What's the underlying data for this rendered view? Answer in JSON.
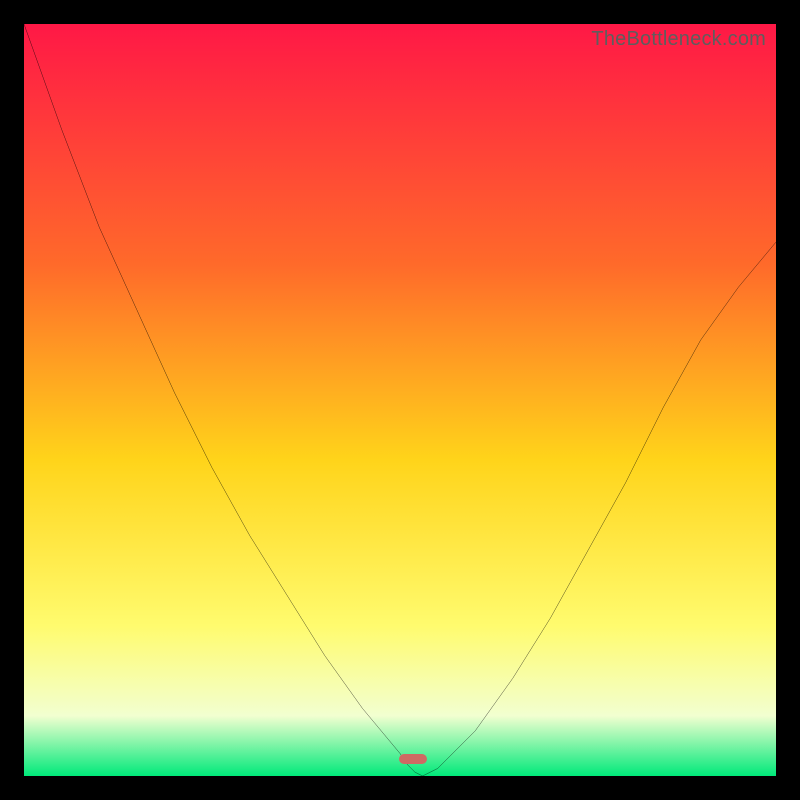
{
  "watermark": "TheBottleneck.com",
  "colors": {
    "frame": "#000000",
    "gradient_top": "#ff1846",
    "gradient_mid1": "#ff6a2a",
    "gradient_mid2": "#ffd41a",
    "gradient_mid3": "#fffb6e",
    "gradient_mid4": "#f2ffd0",
    "gradient_bottom": "#00e97a",
    "curve": "#000000",
    "marker": "#cf6a63"
  },
  "chart_data": {
    "type": "line",
    "title": "",
    "xlabel": "",
    "ylabel": "",
    "x": [
      0.0,
      0.05,
      0.1,
      0.15,
      0.2,
      0.25,
      0.3,
      0.35,
      0.4,
      0.45,
      0.5,
      0.51,
      0.52,
      0.53,
      0.55,
      0.6,
      0.65,
      0.7,
      0.75,
      0.8,
      0.85,
      0.9,
      0.95,
      1.0
    ],
    "series": [
      {
        "name": "curve",
        "values": [
          1.0,
          0.86,
          0.73,
          0.62,
          0.51,
          0.41,
          0.32,
          0.24,
          0.16,
          0.09,
          0.03,
          0.015,
          0.005,
          0.0,
          0.01,
          0.06,
          0.13,
          0.21,
          0.3,
          0.39,
          0.49,
          0.58,
          0.65,
          0.71
        ]
      }
    ],
    "xlim": [
      0,
      1
    ],
    "ylim": [
      0,
      1
    ],
    "min_point": {
      "x": 0.53,
      "y": 0.0
    },
    "marker": {
      "x": 0.517,
      "y": 0.022
    }
  }
}
